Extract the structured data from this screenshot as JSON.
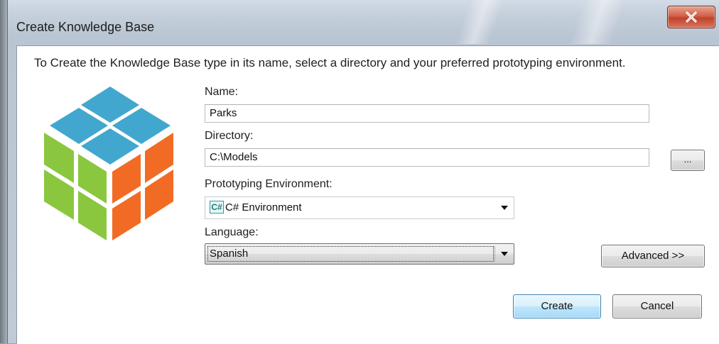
{
  "window": {
    "title": "Create Knowledge Base",
    "close_glyph": "X"
  },
  "dialog": {
    "instruction": "To Create the Knowledge Base type in its name, select a directory and your preferred prototyping environment.",
    "logo": {
      "icon": "rubiks-cube-icon",
      "colors": {
        "top": "#42A7CE",
        "left": "#8AC73F",
        "right": "#F26B24"
      }
    },
    "name": {
      "label": "Name:",
      "value": "Parks"
    },
    "directory": {
      "label": "Directory:",
      "value": "C:\\Models",
      "browse_label": "..."
    },
    "environment": {
      "label": "Prototyping Environment:",
      "icon_text": "C#",
      "selected": "C# Environment"
    },
    "language": {
      "label": "Language:",
      "selected": "Spanish"
    },
    "buttons": {
      "advanced": "Advanced >>",
      "create": "Create",
      "cancel": "Cancel"
    }
  }
}
